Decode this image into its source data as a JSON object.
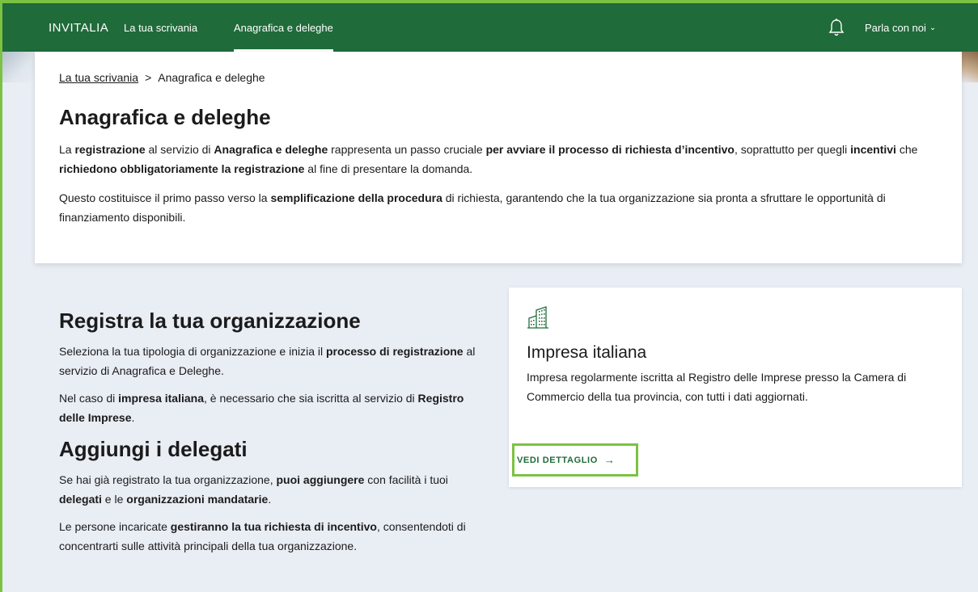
{
  "nav": {
    "logo": "INVITALIA",
    "links": [
      "La tua scrivania",
      "Anagrafica e deleghe"
    ],
    "icon": "bell-icon",
    "contact": "Parla con noi",
    "accent": "#7cc242",
    "bar_color": "#1f6b3a"
  },
  "breadcrumb": {
    "home": "La tua scrivania",
    "separator": ">",
    "current": "Anagrafica e deleghe"
  },
  "intro": {
    "title": "Anagrafica e deleghe",
    "p1": [
      "La ",
      "registrazione",
      " al servizio di ",
      "Anagrafica e deleghe",
      " rappresenta un passo cruciale ",
      "per avviare il processo di richiesta d’incentivo",
      ", soprattutto per quegli ",
      "incentivi",
      " che ",
      "richiedono obbligatoriamente la registrazione",
      " al fine di presentare la domanda."
    ],
    "p2": [
      "Questo costituisce il primo passo verso la ",
      "semplificazione della procedura",
      " di richiesta, garantendo che la tua organizzazione sia pronta a sfruttare le opportunità di finanziamento disponibili."
    ]
  },
  "register": {
    "title": "Registra la tua organizzazione",
    "p1": [
      "Seleziona la tua tipologia di organizzazione e inizia il ",
      "processo di registrazione",
      " al servizio di Anagrafica e Deleghe."
    ],
    "p2": [
      "Nel caso di ",
      "impresa italiana",
      ", è necessario che sia iscritta al servizio di ",
      "Registro delle Imprese",
      "."
    ]
  },
  "delegates": {
    "title": "Aggiungi i delegati",
    "p1": [
      "Se hai già registrato la tua organizzazione, ",
      "puoi aggiungere",
      " con facilità i tuoi ",
      "delegati",
      " e le ",
      "organizzazioni mandatarie",
      "."
    ],
    "p2": [
      "Le persone incaricate ",
      "gestiranno la tua richiesta di incentivo",
      ", consentendoti di concentrarti sulle attività principali della tua organizzazione."
    ]
  },
  "card": {
    "icon": "building-icon",
    "title": "Impresa italiana",
    "text": "Impresa regolarmente iscritta al Registro delle Imprese presso la Camera di Commercio della tua provincia, con tutti i dati aggiornati.",
    "button": "VEDI DETTAGLIO",
    "button_arrow": "→"
  }
}
